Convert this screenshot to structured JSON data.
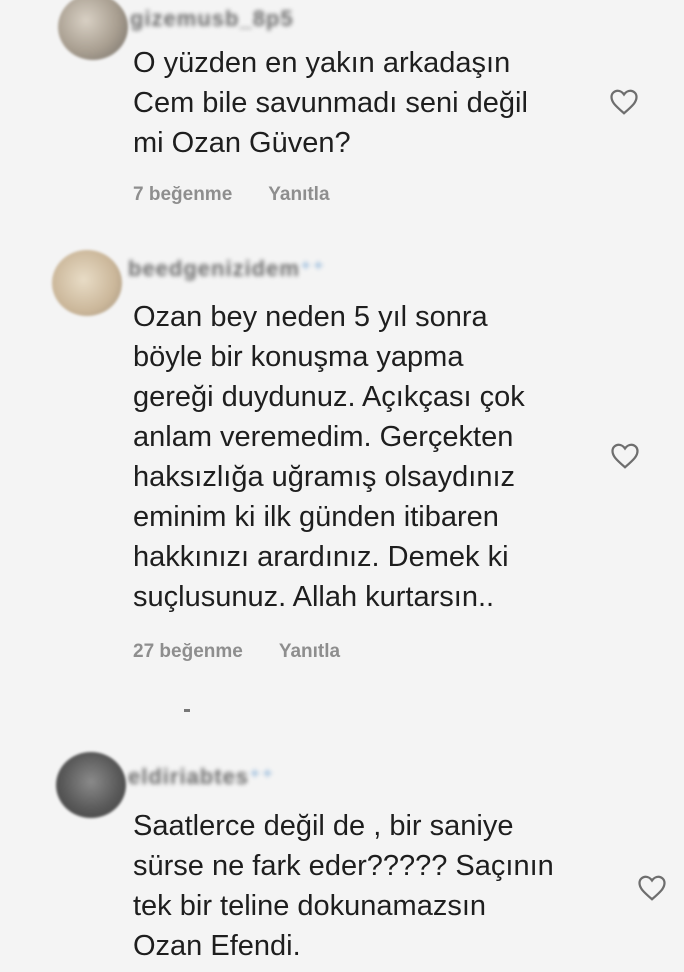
{
  "comments": [
    {
      "username": "gizemusb_8p5",
      "text": "O yüzden en yakın arkadaşın\nCem bile savunmadı seni değil\nmi Ozan Güven?",
      "likes_label": "7 beğenme",
      "reply_label": "Yanıtla"
    },
    {
      "username": "beedgenizidem",
      "text": "Ozan bey neden 5 yıl sonra\nböyle bir konuşma yapma\ngereği duydunuz. Açıkçası çok\nanlam veremedim. Gerçekten\nhaksızlığa uğramış olsaydınız\neminim ki ilk günden itibaren\nhakkınızı arardınız. Demek ki\nsuçlusunuz. Allah kurtarsın..",
      "likes_label": "27 beğenme",
      "reply_label": "Yanıtla"
    },
    {
      "username": "eldiriabtes",
      "text": "Saatlerce değil de , bir saniye\nsürse ne fark eder????? Saçının\ntek bir teline dokunamazsın\nOzan Efendi.",
      "likes_label": "",
      "reply_label": ""
    }
  ],
  "icons": {
    "like": "heart-outline-icon",
    "avatar": "profile-photo"
  },
  "colors": {
    "background": "#f4f4f4",
    "text": "#1e1e1e",
    "meta": "#8e8e8e"
  }
}
